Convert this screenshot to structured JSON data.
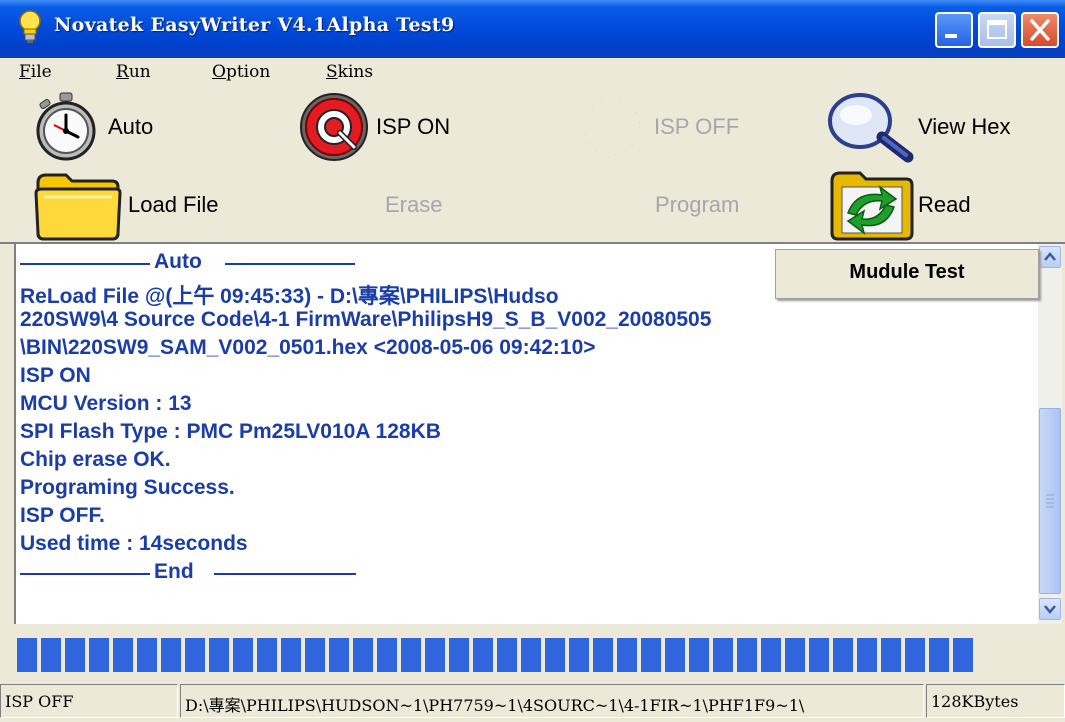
{
  "window": {
    "title": "Novatek EasyWriter V4.1Alpha Test9"
  },
  "menu": [
    {
      "label": "File",
      "accel": "F",
      "rest": "ile"
    },
    {
      "label": "Run",
      "accel": "R",
      "rest": "un"
    },
    {
      "label": "Option",
      "accel": "O",
      "rest": "ption"
    },
    {
      "label": "Skins",
      "accel": "S",
      "rest": "kins"
    }
  ],
  "toolbar": {
    "auto": "Auto",
    "isp_on": "ISP ON",
    "isp_off": "ISP OFF",
    "view_hex": "View Hex",
    "load_file": "Load File",
    "erase": "Erase",
    "program": "Program",
    "read": "Read"
  },
  "popup": {
    "label": "Mudule Test"
  },
  "log": {
    "header": "Auto",
    "lines": [
      "ReLoad File @(上午 09:45:33) - D:\\專案\\PHILIPS\\Hudso",
      "220SW9\\4 Source Code\\4-1 FirmWare\\PhilipsH9_S_B_V002_20080505",
      "\\BIN\\220SW9_SAM_V002_0501.hex <2008-05-06 09:42:10>",
      "ISP ON",
      "MCU Version : 13",
      "SPI Flash Type : PMC Pm25LV010A 128KB",
      "Chip erase OK.",
      "Programing Success.",
      "ISP OFF.",
      "Used time : 14seconds"
    ],
    "footer": "End"
  },
  "progress": {
    "value": 1.0
  },
  "status": {
    "state": "ISP OFF",
    "path": "D:\\專案\\PHILIPS\\HUDSON~1\\PH7759~1\\4SOURC~1\\4-1FIR~1\\PHF1F9~1\\",
    "size": "128KBytes"
  },
  "colors": {
    "log_text": "#1a3da8",
    "progress": "#2f66de",
    "title_bar": "#0048d8"
  }
}
